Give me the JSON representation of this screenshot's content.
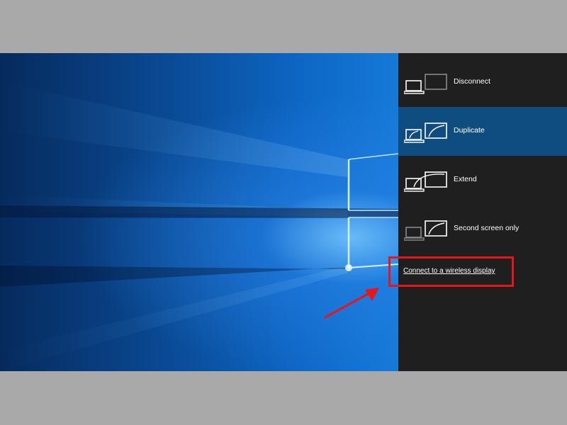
{
  "projection_panel": {
    "options": [
      {
        "label": "Disconnect",
        "icon": "pc-screen-only-icon",
        "selected": false
      },
      {
        "label": "Duplicate",
        "icon": "duplicate-display-icon",
        "selected": true
      },
      {
        "label": "Extend",
        "icon": "extend-display-icon",
        "selected": false
      },
      {
        "label": "Second screen only",
        "icon": "second-screen-only-icon",
        "selected": false
      }
    ],
    "wireless_link": "Connect to a wireless display"
  },
  "colors": {
    "panel_background": "#1f1f1f",
    "selected_background": "#0f4d80",
    "annotation_red": "#e8161b",
    "wallpaper_blue": "#0d66c4"
  }
}
